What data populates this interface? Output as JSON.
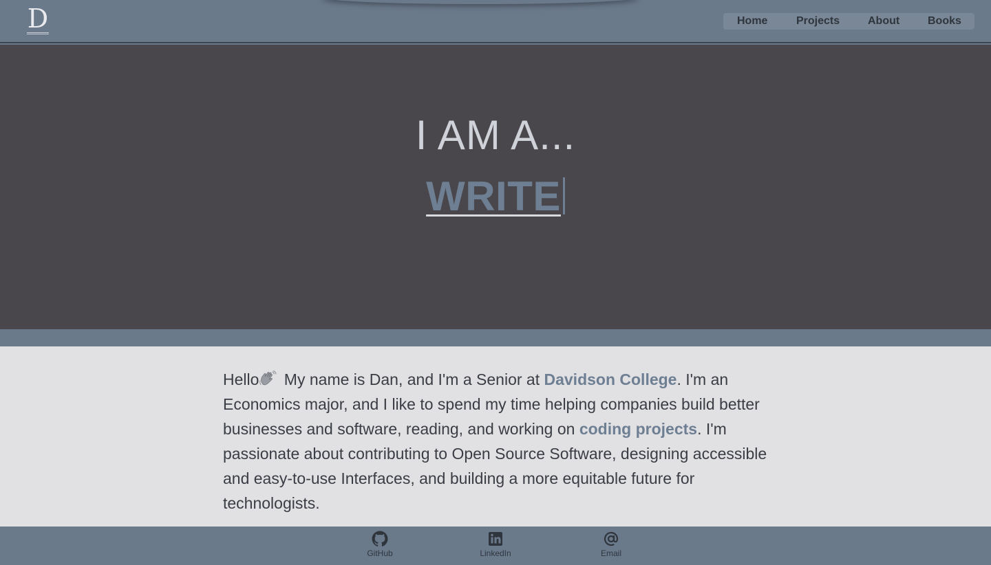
{
  "header": {
    "logo_letter": "D",
    "nav": {
      "home": "Home",
      "projects": "Projects",
      "about": "About",
      "books": "Books"
    }
  },
  "hero": {
    "heading": "I AM A...",
    "typed_word": "WRITE"
  },
  "about": {
    "hello": "Hello",
    "wave_icon": "waving-hand-emoji",
    "text_1": " My name is Dan, and I'm a Senior at ",
    "college_link": "Davidson College",
    "text_2": ". I'm an Economics major, and I like to spend my time helping companies build better businesses and software, reading, and working on ",
    "projects_link": "coding projects",
    "text_3": ". I'm passionate about contributing to Open Source Software, designing accessible and easy-to-use Interfaces, and building a more equitable future for technologists."
  },
  "footer": {
    "links": {
      "github": "GitHub",
      "linkedin": "LinkedIn",
      "email": "Email"
    }
  },
  "colors": {
    "accent": "#6e7f93",
    "navbar": "#6b7a8b",
    "hero_bg": "#49474b",
    "content_bg": "#e1e1e4"
  }
}
